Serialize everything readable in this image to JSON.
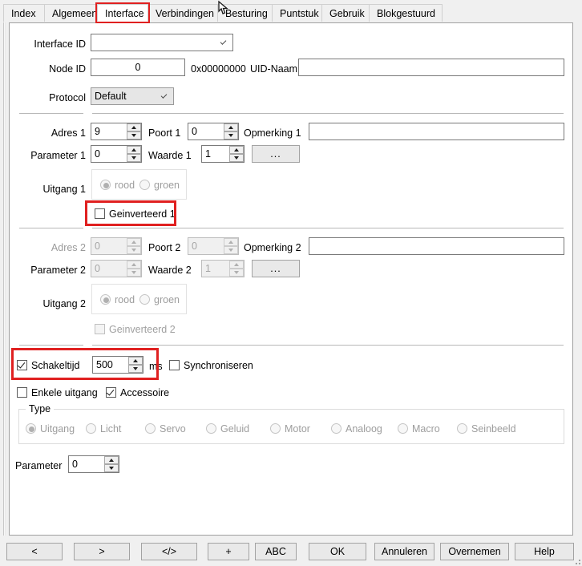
{
  "window": {
    "title": "Interface",
    "accent_highlight_color": "#e02020",
    "panel_bg": "#ffffff",
    "chrome_bg": "#f0f0f0"
  },
  "tabs": [
    {
      "label": "Index",
      "active": false
    },
    {
      "label": "Algemeen",
      "active": false
    },
    {
      "label": "Interface",
      "active": true,
      "highlighted": true
    },
    {
      "label": "Verbindingen",
      "active": false
    },
    {
      "label": "Besturing",
      "active": false
    },
    {
      "label": "Puntstuk",
      "active": false
    },
    {
      "label": "Gebruik",
      "active": false
    },
    {
      "label": "Blokgestuurd",
      "active": false
    }
  ],
  "header": {
    "interface_id_label": "Interface ID",
    "interface_id_value": "",
    "node_id_label": "Node ID",
    "node_id_value": "0",
    "uid_hex": "0x00000000",
    "uid_name_label": "UID-Naam",
    "uid_name_value": "",
    "protocol_label": "Protocol",
    "protocol_value": "Default",
    "protocol_options": [
      "Default"
    ]
  },
  "block1": {
    "adres_label": "Adres 1",
    "adres_value": "9",
    "poort_label": "Poort 1",
    "poort_value": "0",
    "opmerking_label": "Opmerking 1",
    "opmerking_value": "",
    "parameter_label": "Parameter 1",
    "parameter_value": "0",
    "waarde_label": "Waarde 1",
    "waarde_value": "1",
    "browse_label": "...",
    "uitgang_label": "Uitgang 1",
    "uitgang_options": [
      {
        "label": "rood",
        "selected": true
      },
      {
        "label": "groen",
        "selected": false
      }
    ],
    "geinverteerd_label": "Geinverteerd 1",
    "geinverteerd_checked": false,
    "geinverteerd_highlighted": true,
    "enabled": true
  },
  "block2": {
    "adres_label": "Adres 2",
    "adres_value": "0",
    "poort_label": "Poort 2",
    "poort_value": "0",
    "opmerking_label": "Opmerking 2",
    "opmerking_value": "",
    "parameter_label": "Parameter 2",
    "parameter_value": "0",
    "waarde_label": "Waarde 2",
    "waarde_value": "1",
    "browse_label": "...",
    "uitgang_label": "Uitgang 2",
    "uitgang_options": [
      {
        "label": "rood",
        "selected": true
      },
      {
        "label": "groen",
        "selected": false
      }
    ],
    "geinverteerd_label": "Geinverteerd 2",
    "geinverteerd_checked": false,
    "enabled": false
  },
  "timing": {
    "schakeltijd_label": "Schakeltijd",
    "schakeltijd_checked": true,
    "schakeltijd_value": "500",
    "schakeltijd_unit": "ms",
    "schakeltijd_highlighted": true,
    "synchroniseren_label": "Synchroniseren",
    "synchroniseren_checked": false
  },
  "options": {
    "enkele_uitgang_label": "Enkele uitgang",
    "enkele_uitgang_checked": false,
    "accessoire_label": "Accessoire",
    "accessoire_checked": true
  },
  "type_group": {
    "title": "Type",
    "enabled": false,
    "options": [
      {
        "label": "Uitgang",
        "selected": true
      },
      {
        "label": "Licht",
        "selected": false
      },
      {
        "label": "Servo",
        "selected": false
      },
      {
        "label": "Geluid",
        "selected": false
      },
      {
        "label": "Motor",
        "selected": false
      },
      {
        "label": "Analoog",
        "selected": false
      },
      {
        "label": "Macro",
        "selected": false
      },
      {
        "label": "Seinbeeld",
        "selected": false
      }
    ]
  },
  "footer_param": {
    "label": "Parameter",
    "value": "0"
  },
  "buttons": [
    {
      "label": "<",
      "name": "prev-button"
    },
    {
      "label": ">",
      "name": "next-button"
    },
    {
      "label": "</>",
      "name": "code-button"
    },
    {
      "label": "+",
      "name": "add-button"
    },
    {
      "label": "ABC",
      "name": "abc-button"
    },
    {
      "label": "OK",
      "name": "ok-button"
    },
    {
      "label": "Annuleren",
      "name": "cancel-button"
    },
    {
      "label": "Overnemen",
      "name": "apply-button"
    },
    {
      "label": "Help",
      "name": "help-button"
    }
  ]
}
